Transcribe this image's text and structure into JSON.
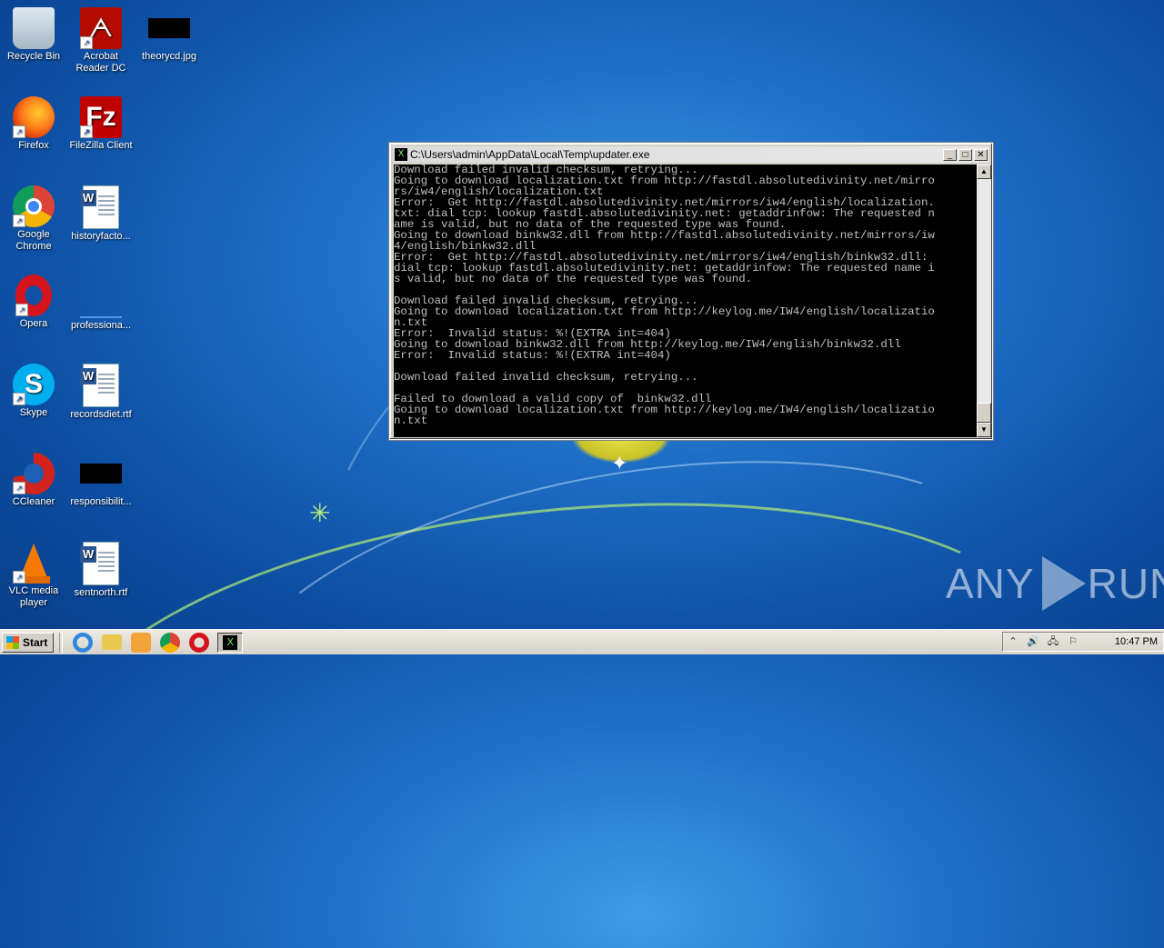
{
  "desktop": {
    "icons": [
      {
        "label": "Recycle Bin",
        "icon": "recycle-bin-icon"
      },
      {
        "label": "Acrobat Reader DC",
        "icon": "acrobat-icon"
      },
      {
        "label": "theorycd.jpg",
        "icon": "image-file-icon"
      },
      {
        "label": "Firefox",
        "icon": "firefox-icon"
      },
      {
        "label": "FileZilla Client",
        "icon": "filezilla-icon"
      },
      {
        "label": "Google Chrome",
        "icon": "chrome-icon"
      },
      {
        "label": "historyfacto...",
        "icon": "word-doc-icon"
      },
      {
        "label": "Opera",
        "icon": "opera-icon"
      },
      {
        "label": "professiona...",
        "icon": "file-icon"
      },
      {
        "label": "Skype",
        "icon": "skype-icon"
      },
      {
        "label": "recordsdiet.rtf",
        "icon": "word-doc-icon"
      },
      {
        "label": "CCleaner",
        "icon": "ccleaner-icon"
      },
      {
        "label": "responsibilit...",
        "icon": "image-file-icon"
      },
      {
        "label": "VLC media player",
        "icon": "vlc-icon"
      },
      {
        "label": "sentnorth.rtf",
        "icon": "word-doc-icon"
      }
    ],
    "acrobat_glyph": "ᗅ",
    "filezilla_glyph": "Fz",
    "skype_glyph": "S"
  },
  "console_window": {
    "title": "C:\\Users\\admin\\AppData\\Local\\Temp\\updater.exe",
    "icon_glyph": "X",
    "minimize": "_",
    "maximize": "□",
    "close": "✕",
    "scroll_up": "▲",
    "scroll_down": "▼",
    "lines": [
      "Download failed invalid checksum, retrying...",
      "Going to download localization.txt from http://fastdl.absolutedivinity.net/mirro",
      "rs/iw4/english/localization.txt",
      "Error:  Get http://fastdl.absolutedivinity.net/mirrors/iw4/english/localization.",
      "txt: dial tcp: lookup fastdl.absolutedivinity.net: getaddrinfow: The requested n",
      "ame is valid, but no data of the requested type was found.",
      "Going to download binkw32.dll from http://fastdl.absolutedivinity.net/mirrors/iw",
      "4/english/binkw32.dll",
      "Error:  Get http://fastdl.absolutedivinity.net/mirrors/iw4/english/binkw32.dll:",
      "dial tcp: lookup fastdl.absolutedivinity.net: getaddrinfow: The requested name i",
      "s valid, but no data of the requested type was found.",
      "",
      "Download failed invalid checksum, retrying...",
      "Going to download localization.txt from http://keylog.me/IW4/english/localizatio",
      "n.txt",
      "Error:  Invalid status: %!(EXTRA int=404)",
      "Going to download binkw32.dll from http://keylog.me/IW4/english/binkw32.dll",
      "Error:  Invalid status: %!(EXTRA int=404)",
      "",
      "Download failed invalid checksum, retrying...",
      "",
      "Failed to download a valid copy of  binkw32.dll",
      "Going to download localization.txt from http://keylog.me/IW4/english/localizatio",
      "n.txt"
    ]
  },
  "watermark": {
    "left": "ANY",
    "right": "RUN"
  },
  "taskbar": {
    "start_label": "Start",
    "quick_launch": [
      "internet-explorer-icon",
      "folder-icon",
      "media-player-icon",
      "chrome-icon",
      "opera-icon"
    ],
    "active_task_glyph": "X",
    "tray": {
      "expand": "⌃",
      "clock": "10:47 PM"
    }
  }
}
